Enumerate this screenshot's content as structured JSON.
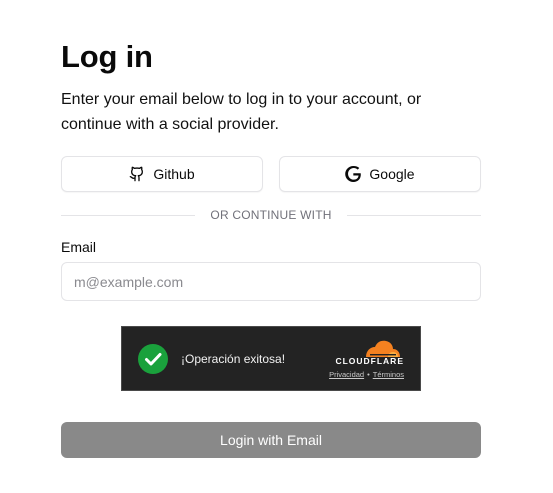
{
  "header": {
    "title": "Log in",
    "subtitle_line1": "Enter your email below to log in to your account, or",
    "subtitle_line2": "continue with a social provider."
  },
  "social": {
    "github_label": "Github",
    "github_icon": "github-icon",
    "google_label": "Google",
    "google_icon": "google-icon"
  },
  "divider": {
    "text": "OR CONTINUE WITH"
  },
  "form": {
    "email_label": "Email",
    "email_placeholder": "m@example.com",
    "email_value": ""
  },
  "captcha": {
    "status_text": "¡Operación exitosa!",
    "status_icon": "check-circle-icon",
    "status_color": "#1aa13c",
    "brand": "CLOUDFLARE",
    "brand_color": "#f48120",
    "privacy_link": "Privacidad",
    "separator": "•",
    "terms_link": "Términos"
  },
  "submit": {
    "label": "Login with Email",
    "background": "#898989"
  }
}
